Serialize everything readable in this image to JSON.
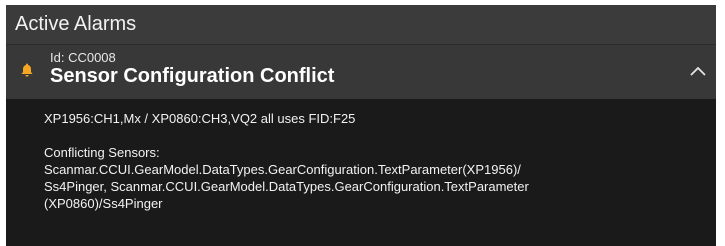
{
  "panel": {
    "title": "Active Alarms"
  },
  "alarm": {
    "id_label": "Id: CC0008",
    "title": "Sensor Configuration Conflict",
    "severity_icon": "bell-icon",
    "expand_icon": "chevron-up-icon",
    "accent_color": "#f5a623",
    "details": {
      "line1": "XP1956:CH1,Mx / XP0860:CH3,VQ2 all uses FID:F25",
      "conflict_heading": "Conflicting Sensors:",
      "conflict_line1": "Scanmar.CCUI.GearModel.DataTypes.GearConfiguration.TextParameter(XP1956)/",
      "conflict_line2": "Ss4Pinger, Scanmar.CCUI.GearModel.DataTypes.GearConfiguration.TextParameter",
      "conflict_line3": "(XP0860)/Ss4Pinger"
    }
  }
}
